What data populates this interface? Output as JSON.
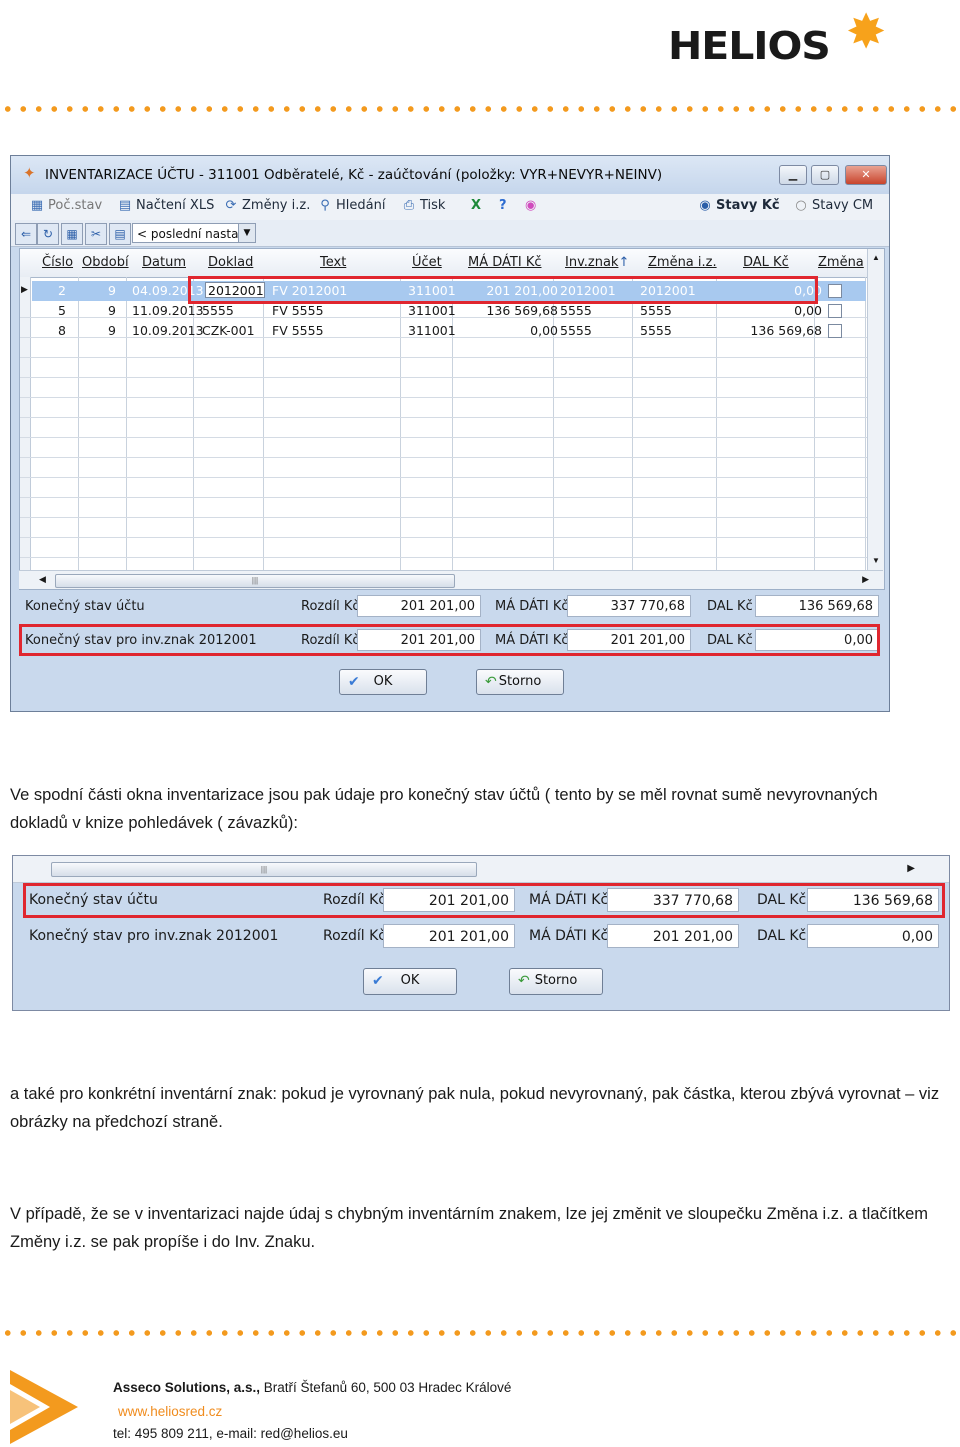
{
  "header": {
    "logo_text": "HELIOS"
  },
  "window": {
    "title": "INVENTARIZACE ÚČTU - 311001  Odběratelé, Kč - zaúčtování   (položky: VYR+NEVYR+NEINV)",
    "toolbar": [
      "Poč.stav",
      "Načtení XLS",
      "Změny i.z.",
      "Hledání",
      "Tisk"
    ],
    "radio_kc": "Stavy Kč",
    "radio_cm": "Stavy CM",
    "combo": "< poslední nastave",
    "columns": [
      "Číslo",
      "Období",
      "Datum",
      "Doklad",
      "Text",
      "Účet",
      "MÁ DÁTI Kč",
      "Inv.znak",
      "Změna i.z.",
      "DAL Kč",
      "Změna"
    ],
    "rows": [
      {
        "cislo": "2",
        "obdobi": "9",
        "datum": "04.09.2013",
        "doklad": "2012001",
        "text": "FV 2012001",
        "ucet": "311001",
        "ma_dati": "201 201,00",
        "inv_znak": "2012001",
        "zmena": "2012001",
        "dal": "0,00"
      },
      {
        "cislo": "5",
        "obdobi": "9",
        "datum": "11.09.2013",
        "doklad": "5555",
        "text": "FV 5555",
        "ucet": "311001",
        "ma_dati": "136 569,68",
        "inv_znak": "5555",
        "zmena": "5555",
        "dal": "0,00"
      },
      {
        "cislo": "8",
        "obdobi": "9",
        "datum": "10.09.2013",
        "doklad": "CZK-001",
        "text": "FV 5555",
        "ucet": "311001",
        "ma_dati": "0,00",
        "inv_znak": "5555",
        "zmena": "5555",
        "dal": "136 569,68"
      }
    ],
    "summary": [
      {
        "label": "Konečný stav účtu",
        "rozdil_label": "Rozdíl Kč",
        "rozdil": "201 201,00",
        "ma_dati_label": "MÁ DÁTI Kč",
        "ma_dati": "337 770,68",
        "dal_label": "DAL Kč",
        "dal": "136 569,68"
      },
      {
        "label": "Konečný stav pro inv.znak 2012001",
        "rozdil_label": "Rozdíl Kč",
        "rozdil": "201 201,00",
        "ma_dati_label": "MÁ DÁTI Kč",
        "ma_dati": "201 201,00",
        "dal_label": "DAL Kč",
        "dal": "0,00"
      }
    ],
    "ok_label": "OK",
    "storno_label": "Storno"
  },
  "text": {
    "p1": "Ve spodní části okna inventarizace jsou pak údaje pro konečný stav účtů ( tento by se měl rovnat sumě nevyrovnaných dokladů v knize pohledávek ( závazků):",
    "p2": " a také pro konkrétní inventární znak: pokud je vyrovnaný pak nula, pokud nevyrovnaný, pak částka, kterou zbývá vyrovnat – viz obrázky na předchozí straně.",
    "p3": "V případě, že se v inventarizaci najde údaj s chybným inventárním znakem, lze jej změnit ve sloupečku Změna i.z. a tlačítkem Změny i.z. se pak propíše i do Inv. Znaku."
  },
  "footer": {
    "company": "Asseco Solutions, a.s.,",
    "address": " Bratří Štefanů 60, 500 03 Hradec Králové",
    "web": "www.heliosred.cz",
    "contact": "tel: 495 809 211, e-mail: red@helios.eu"
  },
  "colors": {
    "accent": "#f39a1e",
    "highlight_red": "#e0262f",
    "selection": "#a8c9ef"
  }
}
